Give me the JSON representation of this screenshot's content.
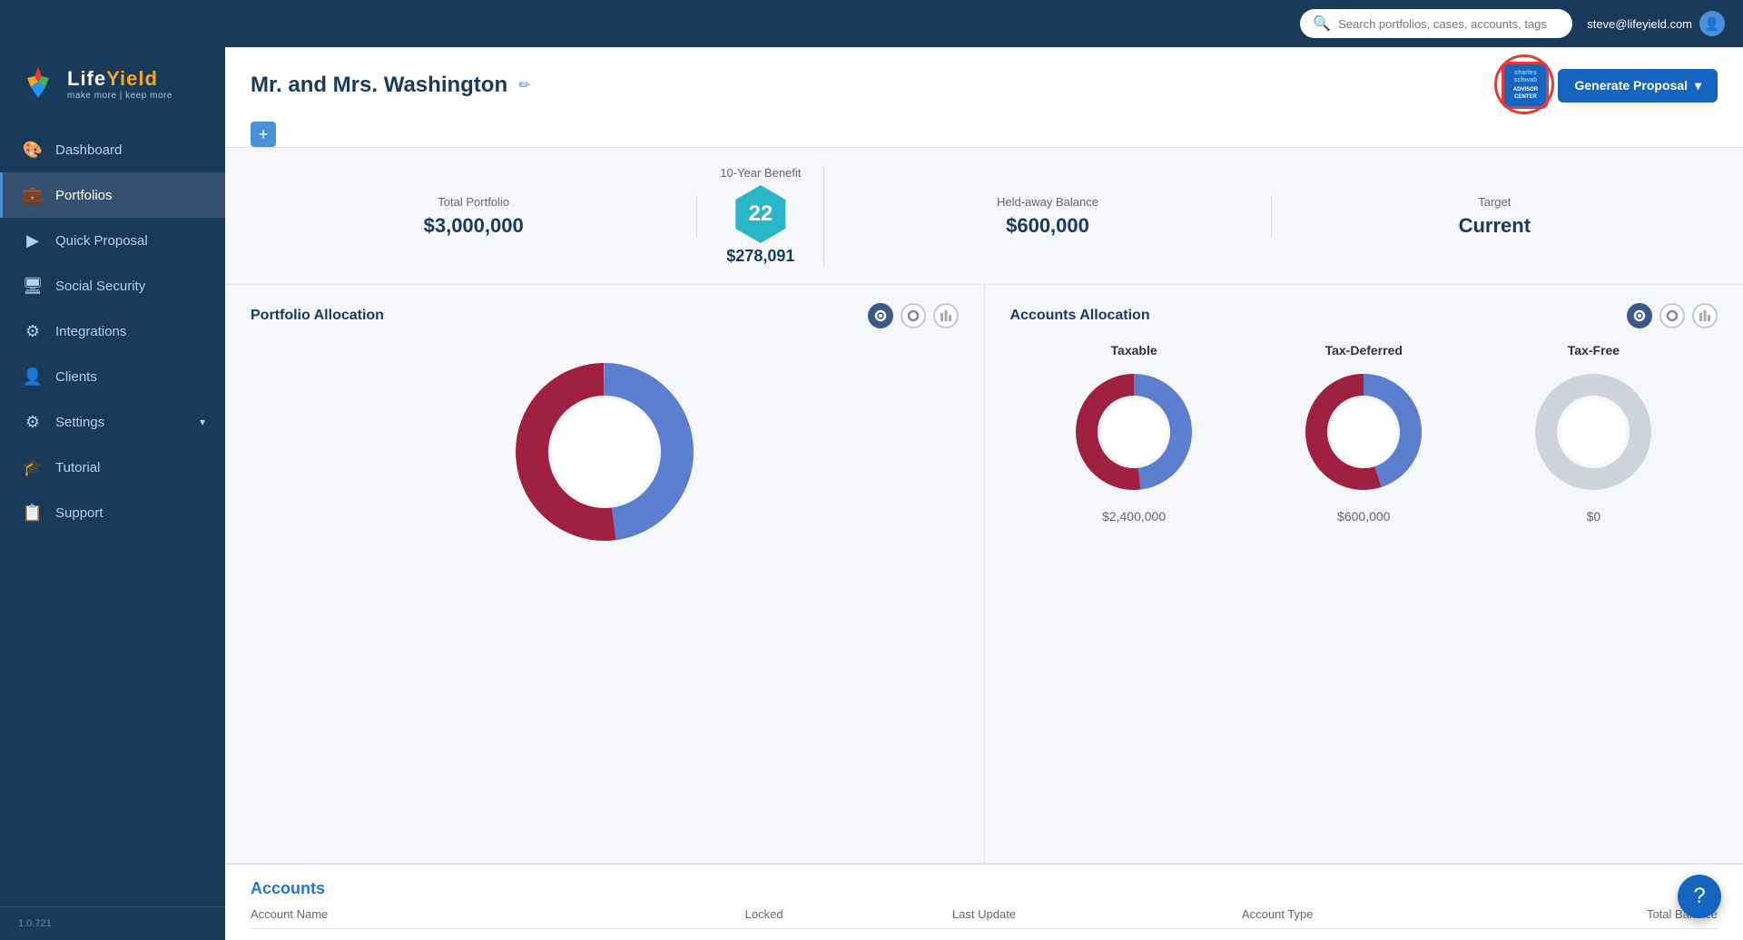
{
  "topbar": {
    "search_placeholder": "Search portfolios, cases, accounts, tags",
    "user_email": "steve@lifeyield.com"
  },
  "logo": {
    "brand_life": "Life",
    "brand_yield": "Yield",
    "tagline": "make more | keep more"
  },
  "sidebar": {
    "items": [
      {
        "id": "dashboard",
        "label": "Dashboard",
        "icon": "🎨",
        "active": false
      },
      {
        "id": "portfolios",
        "label": "Portfolios",
        "icon": "💼",
        "active": true
      },
      {
        "id": "quick-proposal",
        "label": "Quick Proposal",
        "icon": "▶",
        "active": false
      },
      {
        "id": "social-security",
        "label": "Social Security",
        "icon": "🖥",
        "active": false
      },
      {
        "id": "integrations",
        "label": "Integrations",
        "icon": "⚙",
        "active": false
      },
      {
        "id": "clients",
        "label": "Clients",
        "icon": "👤",
        "active": false
      },
      {
        "id": "settings",
        "label": "Settings",
        "icon": "⚙",
        "active": false,
        "has_chevron": true
      },
      {
        "id": "tutorial",
        "label": "Tutorial",
        "icon": "🎓",
        "active": false
      },
      {
        "id": "support",
        "label": "Support",
        "icon": "📋",
        "active": false
      }
    ],
    "version": "1.0.721"
  },
  "page": {
    "title": "Mr. and Mrs. Washington",
    "add_button_label": "+",
    "generate_button_label": "Generate Proposal"
  },
  "stats": [
    {
      "label": "Total Portfolio",
      "value": "$3,000,000"
    },
    {
      "label": "10-Year Benefit",
      "value": "$278,091",
      "is_hex": true,
      "hex_number": "22"
    },
    {
      "label": "Held-away Balance",
      "value": "$600,000"
    },
    {
      "label": "Target",
      "value": "Current"
    }
  ],
  "portfolio_allocation": {
    "title": "Portfolio Allocation",
    "donut": {
      "blue_pct": 48,
      "red_pct": 52,
      "blue_color": "#5b7fce",
      "red_color": "#a02040"
    }
  },
  "accounts_allocation": {
    "title": "Accounts Allocation",
    "items": [
      {
        "label": "Taxable",
        "value": "$2,400,000",
        "blue_pct": 48,
        "red_pct": 52,
        "has_data": true
      },
      {
        "label": "Tax-Deferred",
        "value": "$600,000",
        "blue_pct": 45,
        "red_pct": 55,
        "has_data": true
      },
      {
        "label": "Tax-Free",
        "value": "$0",
        "blue_pct": 0,
        "red_pct": 0,
        "has_data": false
      }
    ]
  },
  "accounts_table": {
    "title": "Accounts",
    "columns": [
      "Account Name",
      "Locked",
      "Last Update",
      "Account Type",
      "Total Balance"
    ]
  },
  "advisor_center": {
    "line1": "charles",
    "line2": "schwab",
    "line3": "ADVISOR",
    "line4": "CENTER"
  }
}
